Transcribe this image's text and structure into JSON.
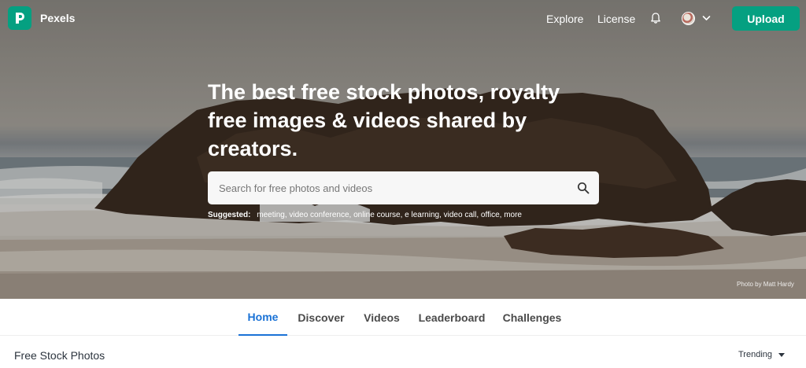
{
  "brand": {
    "name": "Pexels"
  },
  "nav": {
    "explore": "Explore",
    "license": "License",
    "upload": "Upload"
  },
  "hero": {
    "headline": "The best free stock photos, royalty free images & videos shared by creators.",
    "search": {
      "placeholder": "Search for free photos and videos",
      "value": ""
    },
    "suggested_label": "Suggested:",
    "suggestions": [
      "meeting",
      "video conference",
      "online course",
      "e learning",
      "video call",
      "office",
      "more"
    ],
    "photo_credit": "Photo by Matt Hardy"
  },
  "tabs": [
    {
      "label": "Home",
      "active": true
    },
    {
      "label": "Discover",
      "active": false
    },
    {
      "label": "Videos",
      "active": false
    },
    {
      "label": "Leaderboard",
      "active": false
    },
    {
      "label": "Challenges",
      "active": false
    }
  ],
  "section": {
    "title": "Free Stock Photos",
    "sort": "Trending"
  },
  "colors": {
    "brand_green": "#05a081",
    "active_tab": "#1a72d6"
  },
  "icons": [
    "pexels-logo-icon",
    "bell-icon",
    "avatar",
    "chevron-down-icon",
    "search-icon",
    "caret-down-icon"
  ]
}
